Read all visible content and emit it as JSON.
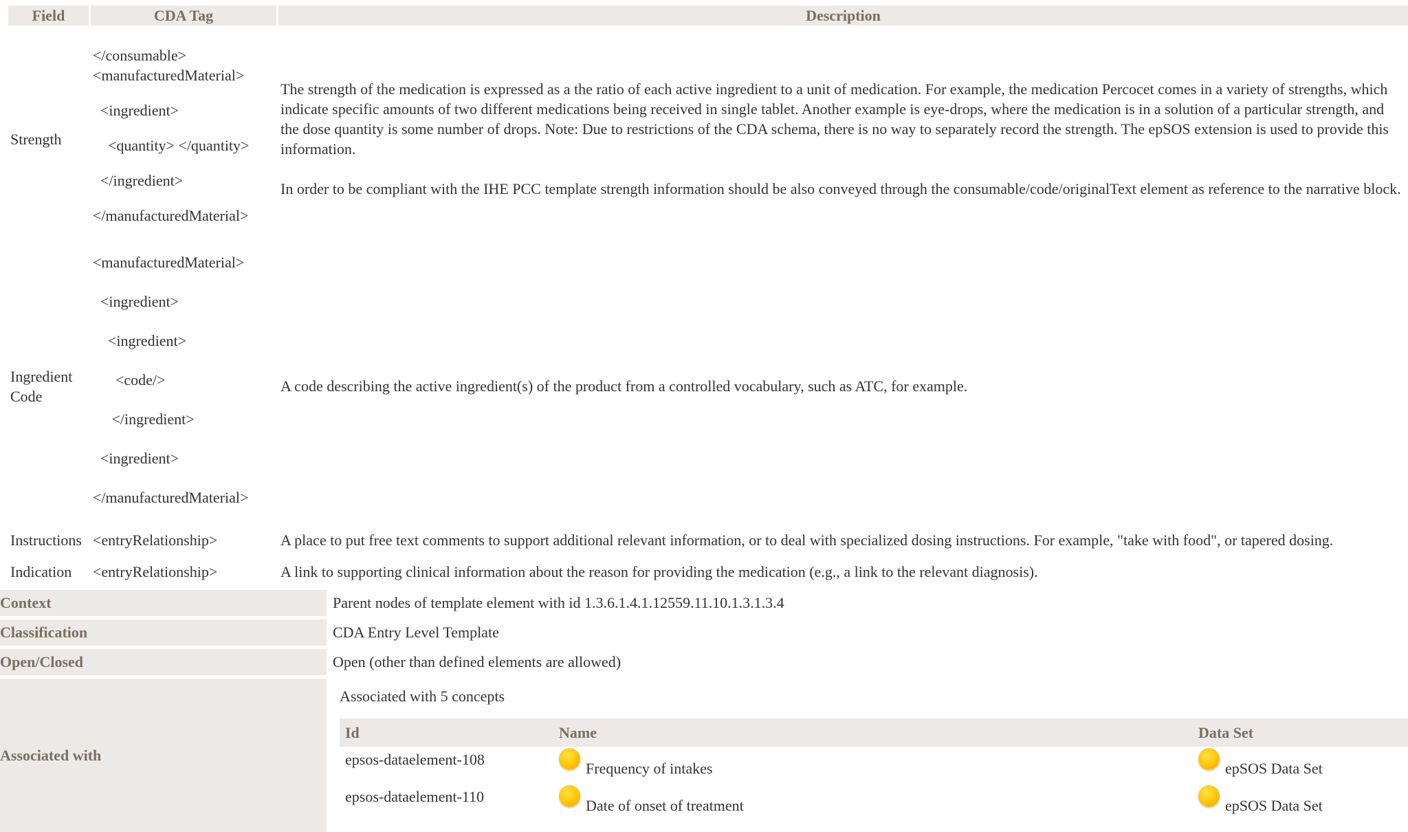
{
  "fields_table": {
    "headers": {
      "field": "Field",
      "cda_tag": "CDA Tag",
      "description": "Description"
    },
    "rows": [
      {
        "field": "Strength",
        "tags": [
          "</consumable>",
          "<manufacturedMaterial>",
          "",
          "  <ingredient>",
          "",
          "    <quantity> </quantity>",
          "",
          "  </ingredient>",
          "",
          "</manufacturedMaterial>"
        ],
        "description": [
          "The strength of the medication is expressed as a the ratio of each active ingredient to a unit of medication. For example, the medication Percocet comes in a variety of strengths, which indicate specific amounts of two different medications being received in single tablet. Another example is eye-drops, where the medication is in a solution of a particular strength, and the dose quantity is some number of drops. Note: Due to restrictions of the CDA schema, there is no way to separately record the strength. The epSOS extension is used to provide this information.",
          "In order to be compliant with the IHE PCC template strength information should be also conveyed through the consumable/code/originalText element as reference to the narrative block."
        ]
      },
      {
        "field": "Ingredient Code",
        "tags": [
          "<manufacturedMaterial>",
          "",
          "  <ingredient>",
          "",
          "    <ingredient>",
          "",
          "      <code/>",
          "",
          "     </ingredient>",
          "",
          "  <ingredient>",
          "",
          "</manufacturedMaterial>"
        ],
        "description": [
          "A code describing the active ingredient(s) of the product from a controlled vocabulary, such as ATC, for example."
        ]
      },
      {
        "field": "Instructions",
        "tags": [
          "<entryRelationship>"
        ],
        "description": [
          "A place to put free text comments to support additional relevant information, or to deal with specialized dosing instructions. For example, \"take with food\", or tapered dosing."
        ]
      },
      {
        "field": "Indication",
        "tags": [
          "<entryRelationship>"
        ],
        "description": [
          "A link to supporting clinical information about the reason for providing the medication (e.g., a link to the relevant diagnosis)."
        ]
      }
    ]
  },
  "meta": {
    "context": {
      "label": "Context",
      "value": "Parent nodes of template element with id 1.3.6.1.4.1.12559.11.10.1.3.1.3.4"
    },
    "classification": {
      "label": "Classification",
      "value": "CDA Entry Level Template"
    },
    "open_closed": {
      "label": "Open/Closed",
      "value": "Open (other than defined elements are allowed)"
    },
    "associated_with": {
      "label": "Associated with"
    }
  },
  "associations": {
    "caption": "Associated with 5 concepts",
    "headers": {
      "id": "Id",
      "name": "Name",
      "data_set": "Data Set"
    },
    "rows": [
      {
        "id": "epsos-dataelement-108",
        "name": "Frequency of intakes",
        "data_set": "epSOS Data Set",
        "icon": "yellow-dot-icon"
      },
      {
        "id": "epsos-dataelement-110",
        "name": "Date of onset of treatment",
        "data_set": "epSOS Data Set",
        "icon": "yellow-dot-icon"
      }
    ]
  },
  "colors": {
    "header_bg": "#ece9e6",
    "header_text": "#7a6e62",
    "body_text": "#333333",
    "dot": "#ffc400"
  }
}
